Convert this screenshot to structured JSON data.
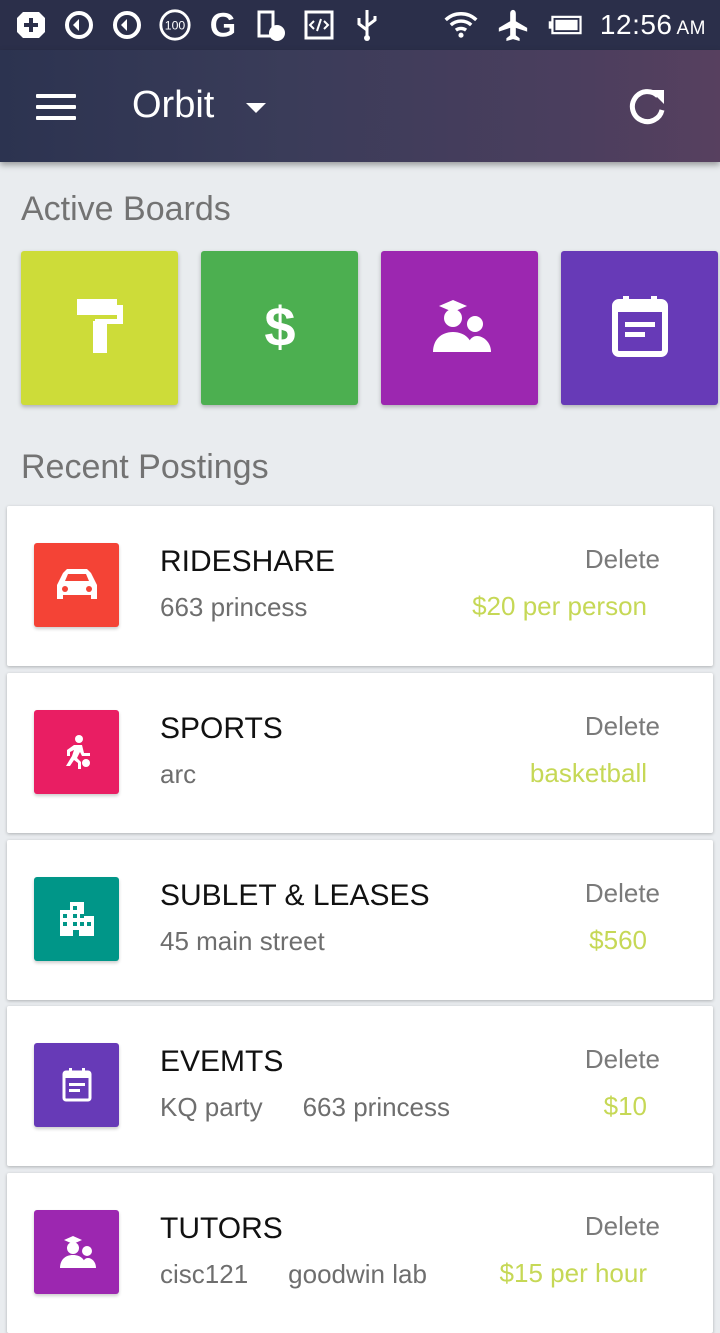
{
  "status_bar": {
    "time": "12:56",
    "ampm": "AM",
    "left_icons": [
      "add-box-icon",
      "sync-icon",
      "sync-icon",
      "battery-100-icon",
      "google-icon",
      "battery-check-icon",
      "code-icon",
      "usb-icon"
    ],
    "right_icons": [
      "wifi-icon",
      "airplane-icon",
      "battery-icon"
    ],
    "background": "#2b2f4a"
  },
  "app_bar": {
    "title": "Orbit",
    "menu_icon": "hamburger-menu-icon",
    "dropdown_icon": "caret-down-icon",
    "refresh_icon": "refresh-icon"
  },
  "active_boards": {
    "heading": "Active Boards",
    "boards": [
      {
        "icon": "paint-roller-icon",
        "color": "#cddc39"
      },
      {
        "icon": "dollar-icon",
        "color": "#4caf50"
      },
      {
        "icon": "tutor-icon",
        "color": "#9c27b0"
      },
      {
        "icon": "event-icon",
        "color": "#673ab7"
      }
    ]
  },
  "recent_postings": {
    "heading": "Recent Postings",
    "delete_label": "Delete",
    "price_color": "#c6d856",
    "items": [
      {
        "category": "RIDESHARE",
        "detail": "663 princess",
        "detail2": "",
        "price": "$20 per person",
        "icon": "car-icon",
        "color": "#f44336"
      },
      {
        "category": "SPORTS",
        "detail": "arc",
        "detail2": "",
        "price": "basketball",
        "icon": "sports-icon",
        "color": "#e91e63"
      },
      {
        "category": "SUBLET & LEASES",
        "detail": "45 main street",
        "detail2": "",
        "price": "$560",
        "icon": "building-icon",
        "color": "#009688"
      },
      {
        "category": "EVEMTS",
        "detail": "KQ party",
        "detail2": "663 princess",
        "price": "$10",
        "icon": "event-icon",
        "color": "#673ab7"
      },
      {
        "category": "TUTORS",
        "detail": "cisc121",
        "detail2": "goodwin lab",
        "price": "$15 per hour",
        "icon": "tutor-icon",
        "color": "#9c27b0"
      }
    ]
  }
}
